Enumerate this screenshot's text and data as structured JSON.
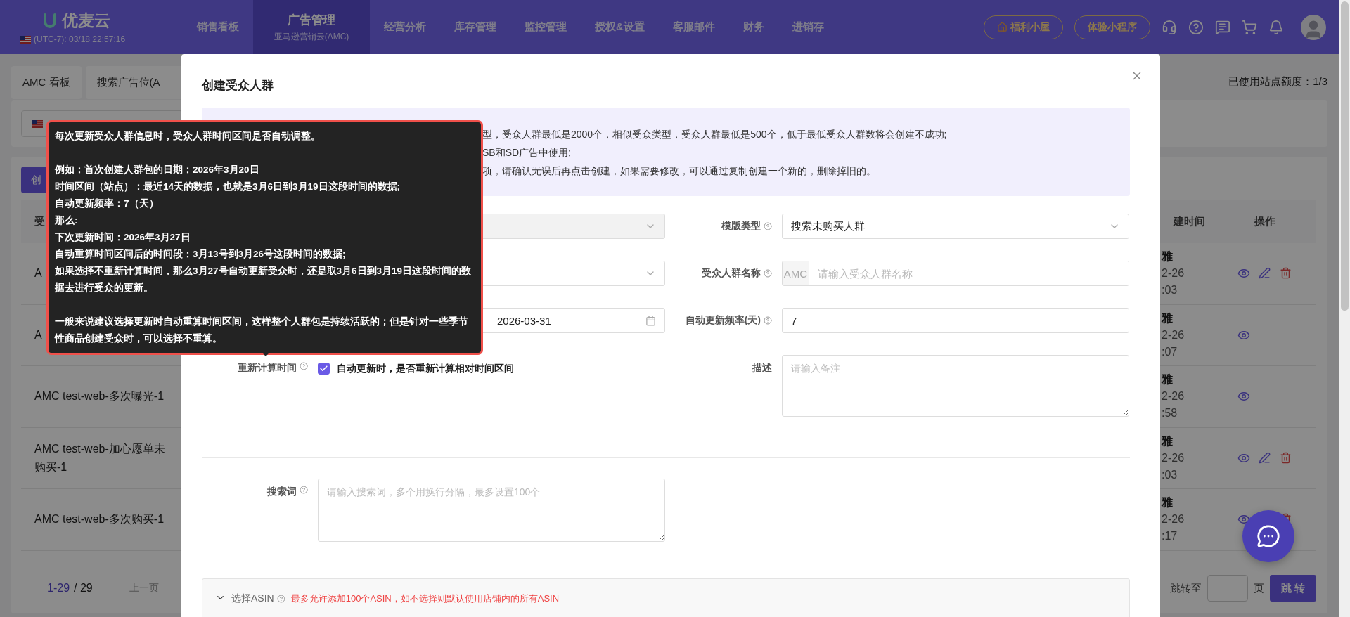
{
  "nav": {
    "logo": "优麦云",
    "time": "(UTC-7): 03/18 22:57:16",
    "items": [
      {
        "label": "销售看板",
        "selected": false
      },
      {
        "label": "广告管理",
        "sub": "亚马逊营销云(AMC)",
        "selected": true
      },
      {
        "label": "经营分析",
        "selected": false
      },
      {
        "label": "库存管理",
        "selected": false
      },
      {
        "label": "监控管理",
        "selected": false
      },
      {
        "label": "授权&设置",
        "selected": false
      },
      {
        "label": "客服邮件",
        "selected": false
      },
      {
        "label": "财务",
        "selected": false
      },
      {
        "label": "进销存",
        "selected": false
      }
    ],
    "buttons": [
      "福利小屋",
      "体验小程序"
    ]
  },
  "page": {
    "tabs": [
      "AMC 看板",
      "搜索广告位(A"
    ],
    "quota": "已使用站点额度：1/3",
    "create_button": "创",
    "columns": [
      "受",
      "建时间",
      "操作"
    ],
    "rows": [
      {
        "name": "A",
        "creator": "雅",
        "date": "2-26",
        "time": ":03",
        "view": true,
        "edit": true,
        "delete": true
      },
      {
        "name": "A",
        "creator": "雅",
        "date": "2-26",
        "time": ":07",
        "view": true,
        "edit": false,
        "delete": false
      },
      {
        "name": "AMC test-web-多次曝光-1",
        "creator": "雅",
        "date": "2-26",
        "time": ":58",
        "view": true,
        "edit": false,
        "delete": false
      },
      {
        "name": "AMC test-web-加心愿单未购买-1",
        "creator": "雅",
        "date": "2-26",
        "time": ":03",
        "view": true,
        "edit": true,
        "delete": true
      },
      {
        "name": "AMC test-web-多次购买-1",
        "creator": "雅",
        "date": "2-26",
        "time": ":17",
        "view": true,
        "edit": false,
        "delete": true
      }
    ],
    "pagination": {
      "range": "1-29",
      "total": "/ 29",
      "prev": "上一页",
      "jump_label": "跳转至",
      "page_unit": "页",
      "jump_button": "跳 转"
    }
  },
  "modal": {
    "title": "创建受众人群",
    "notice": [
      "型，受众人群最低是2000个，相似受众类型，受众人群最低是500个，低于最低受众人群数将会创建不成功;",
      "SB和SD广告中使用;",
      "项，请确认无误后再点击创建，如果需要修改，可以通过复制创建一个新的，删除掉旧的。"
    ],
    "left_fields": [
      {
        "kind": "select",
        "disabled": true
      },
      {
        "kind": "select",
        "disabled": false
      },
      {
        "kind": "date",
        "value": "2026-03-31"
      }
    ],
    "right_fields": [
      {
        "kind": "select",
        "label": "模版类型",
        "value": "搜索未购买人群"
      },
      {
        "kind": "prefixed",
        "label": "受众人群名称",
        "prefix": "AMC",
        "placeholder": "请输入受众人群名称"
      },
      {
        "kind": "text",
        "label": "自动更新频率(天)",
        "value": "7"
      }
    ],
    "recalc": {
      "label": "重新计算时间",
      "checked": true,
      "text": "自动更新时，是否重新计算相对时间区间"
    },
    "description": {
      "label": "描述",
      "placeholder": "请输入备注"
    },
    "search_terms": {
      "label": "搜索词",
      "placeholder": "请输入搜索词，多个用换行分隔，最多设置100个"
    },
    "asin": {
      "label": "选择ASIN",
      "hint": "最多允许添加100个ASIN，如不选择则默认使用店铺内的所有ASIN"
    }
  },
  "tooltip": {
    "paragraphs": [
      [
        "每次更新受众人群信息时，受众人群时间区间是否自动调整。"
      ],
      [
        "例如：首次创建人群包的日期：2026年3月20日",
        "时间区间（站点）：最近14天的数据，也就是3月6日到3月19日这段时间的数据;",
        "自动更新频率：7（天）",
        "那么:",
        "下次更新时间：2026年3月27日",
        "自动重算时间区间后的时间段：3月13号到3月26号这段时间的数据;",
        "如果选择不重新计算时间，那么3月27号自动更新受众时，还是取3月6日到3月19日这段时间的数据去进行受众的更新。"
      ],
      [
        "一般来说建议选择更新时自动重算时间区间，这样整个人群包是持续活跃的；但是针对一些季节性商品创建受众时，可以选择不重算。"
      ]
    ]
  }
}
